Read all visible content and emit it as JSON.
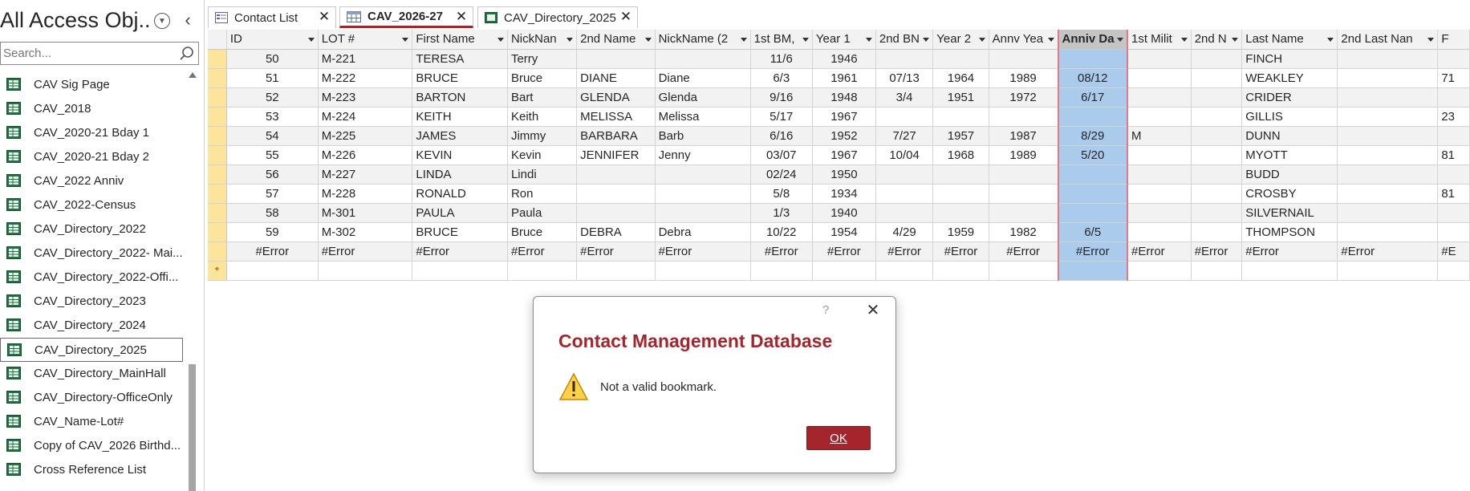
{
  "nav": {
    "title": "All Access Obj...",
    "search_placeholder": "Search...",
    "items": [
      {
        "label": "CAV Sig Page"
      },
      {
        "label": "CAV_2018"
      },
      {
        "label": "CAV_2020-21 Bday 1"
      },
      {
        "label": "CAV_2020-21 Bday 2"
      },
      {
        "label": "CAV_2022 Anniv"
      },
      {
        "label": "CAV_2022-Census"
      },
      {
        "label": "CAV_Directory_2022"
      },
      {
        "label": "CAV_Directory_2022- Mai..."
      },
      {
        "label": "CAV_Directory_2022-Offi..."
      },
      {
        "label": "CAV_Directory_2023"
      },
      {
        "label": "CAV_Directory_2024"
      },
      {
        "label": "CAV_Directory_2025"
      },
      {
        "label": "CAV_Directory_MainHall"
      },
      {
        "label": "CAV_Directory-OfficeOnly"
      },
      {
        "label": "CAV_Name-Lot#"
      },
      {
        "label": "Copy of CAV_2026 Birthd..."
      },
      {
        "label": "Cross Reference List"
      }
    ],
    "selected_index": 11
  },
  "tabs": [
    {
      "label": "Contact List",
      "active": false,
      "icon": "form-icon"
    },
    {
      "label": "CAV_2026-27",
      "active": true,
      "icon": "query-icon"
    },
    {
      "label": "CAV_Directory_2025",
      "active": false,
      "icon": "table-icon"
    }
  ],
  "grid": {
    "columns": [
      "ID",
      "LOT #",
      "First Name",
      "NickNan",
      "2nd Name",
      "NickName (2",
      "1st BM,",
      "Year 1",
      "2nd BN",
      "Year 2",
      "Annv Yea",
      "Anniv Da",
      "1st Milit",
      "2nd N",
      "Last Name",
      "2nd Last Nan",
      "F"
    ],
    "selected_column": 11,
    "rows": [
      [
        "50",
        "M-221",
        "TERESA",
        "Terry",
        "",
        "",
        "11/6",
        "1946",
        "",
        "",
        "",
        "",
        "",
        "",
        "FINCH",
        "",
        ""
      ],
      [
        "51",
        "M-222",
        "BRUCE",
        "Bruce",
        "DIANE",
        "Diane",
        "6/3",
        "1961",
        "07/13",
        "1964",
        "1989",
        "08/12",
        "",
        "",
        "WEAKLEY",
        "",
        "71"
      ],
      [
        "52",
        "M-223",
        "BARTON",
        "Bart",
        "GLENDA",
        "Glenda",
        "9/16",
        "1948",
        "3/4",
        "1951",
        "1972",
        "6/17",
        "",
        "",
        "CRIDER",
        "",
        ""
      ],
      [
        "53",
        "M-224",
        "KEITH",
        "Keith",
        "MELISSA",
        "Melissa",
        "5/17",
        "1967",
        "",
        "",
        "",
        "",
        "",
        "",
        "GILLIS",
        "",
        "23"
      ],
      [
        "54",
        "M-225",
        "JAMES",
        "Jimmy",
        "BARBARA",
        "Barb",
        "6/16",
        "1952",
        "7/27",
        "1957",
        "1987",
        "8/29",
        "M",
        "",
        "DUNN",
        "",
        ""
      ],
      [
        "55",
        "M-226",
        "KEVIN",
        "Kevin",
        "JENNIFER",
        "Jenny",
        "03/07",
        "1967",
        "10/04",
        "1968",
        "1989",
        "5/20",
        "",
        "",
        "MYOTT",
        "",
        "81"
      ],
      [
        "56",
        "M-227",
        "LINDA",
        "Lindi",
        "",
        "",
        "02/24",
        "1950",
        "",
        "",
        "",
        "",
        "",
        "",
        "BUDD",
        "",
        ""
      ],
      [
        "57",
        "M-228",
        "RONALD",
        "Ron",
        "",
        "",
        "5/8",
        "1934",
        "",
        "",
        "",
        "",
        "",
        "",
        "CROSBY",
        "",
        "81"
      ],
      [
        "58",
        "M-301",
        "PAULA",
        "Paula",
        "",
        "",
        "1/3",
        "1940",
        "",
        "",
        "",
        "",
        "",
        "",
        "SILVERNAIL",
        "",
        ""
      ],
      [
        "59",
        "M-302",
        "BRUCE",
        "Bruce",
        "DEBRA",
        "Debra",
        "10/22",
        "1954",
        "4/29",
        "1959",
        "1982",
        "6/5",
        "",
        "",
        "THOMPSON",
        "",
        ""
      ],
      [
        "#Error",
        "#Error",
        "#Error",
        "#Error",
        "#Error",
        "#Error",
        "#Error",
        "#Error",
        "#Error",
        "#Error",
        "#Error",
        "#Error",
        "#Error",
        "#Error",
        "#Error",
        "#Error",
        "#E"
      ]
    ],
    "new_row_marker": "*"
  },
  "dialog": {
    "help": "?",
    "title": "Contact Management Database",
    "message": "Not a valid bookmark.",
    "ok_label": "OK"
  },
  "colors": {
    "accent": "#a4262c",
    "selected_column": "#aacbeb",
    "row_selector": "#fce49a",
    "table_icon": "#217346"
  }
}
